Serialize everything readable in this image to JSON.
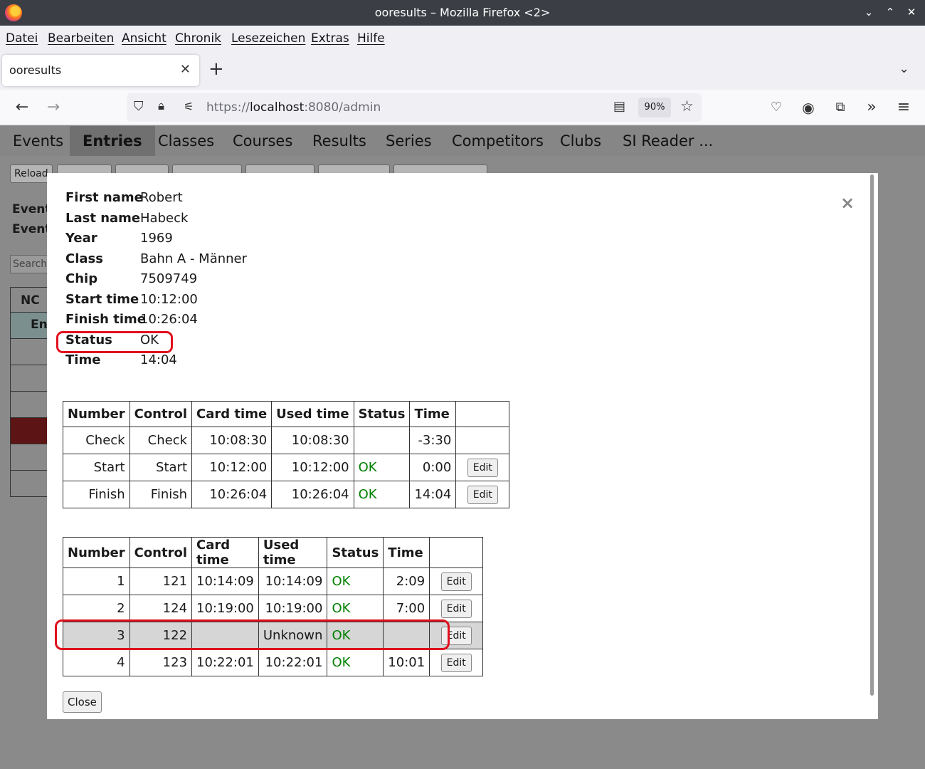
{
  "window": {
    "title": "ooresults – Mozilla Firefox <2>"
  },
  "menu": [
    "Datei",
    "Bearbeiten",
    "Ansicht",
    "Chronik",
    "Lesezeichen",
    "Extras",
    "Hilfe"
  ],
  "tab": {
    "title": "ooresults"
  },
  "url": {
    "scheme": "https://",
    "host": "localhost",
    "rest": ":8080/admin",
    "zoom": "90%"
  },
  "topnav": [
    "Events",
    "Entries",
    "Classes",
    "Courses",
    "Results",
    "Series",
    "Competitors",
    "Clubs",
    "SI Reader ..."
  ],
  "background": {
    "reload_label": "Reload",
    "event_label_1": "Event",
    "event_label_2": "Event",
    "search_placeholder": "Search",
    "table_head": "NC",
    "table_sub": "Ent"
  },
  "details": [
    {
      "label": "First name",
      "value": "Robert"
    },
    {
      "label": "Last name",
      "value": "Habeck"
    },
    {
      "label": "Year",
      "value": "1969"
    },
    {
      "label": "Class",
      "value": "Bahn A - Männer"
    },
    {
      "label": "Chip",
      "value": "7509749"
    },
    {
      "label": "Start time",
      "value": "10:12:00"
    },
    {
      "label": "Finish time",
      "value": "10:26:04"
    },
    {
      "label": "Status",
      "value": "OK"
    },
    {
      "label": "Time",
      "value": "14:04"
    }
  ],
  "columns": [
    "Number",
    "Control",
    "Card time",
    "Used time",
    "Status",
    "Time",
    ""
  ],
  "edit_label": "Edit",
  "table1": [
    {
      "number": "Check",
      "control": "Check",
      "card_time": "10:08:30",
      "used_time": "10:08:30",
      "status": "",
      "time": "-3:30",
      "edit": false
    },
    {
      "number": "Start",
      "control": "Start",
      "card_time": "10:12:00",
      "used_time": "10:12:00",
      "status": "OK",
      "time": "0:00",
      "edit": true
    },
    {
      "number": "Finish",
      "control": "Finish",
      "card_time": "10:26:04",
      "used_time": "10:26:04",
      "status": "OK",
      "time": "14:04",
      "edit": true
    }
  ],
  "table2": [
    {
      "number": "1",
      "control": "121",
      "card_time": "10:14:09",
      "used_time": "10:14:09",
      "status": "OK",
      "time": "2:09",
      "edit": true
    },
    {
      "number": "2",
      "control": "124",
      "card_time": "10:19:00",
      "used_time": "10:19:00",
      "status": "OK",
      "time": "7:00",
      "edit": true
    },
    {
      "number": "3",
      "control": "122",
      "card_time": "",
      "used_time": "Unknown",
      "status": "OK",
      "time": "",
      "edit": true,
      "selected": true
    },
    {
      "number": "4",
      "control": "123",
      "card_time": "10:22:01",
      "used_time": "10:22:01",
      "status": "OK",
      "time": "10:01",
      "edit": true
    }
  ],
  "close_label": "Close",
  "close_x": "×",
  "colors": {
    "ok": "#008000",
    "highlight": "#e0101e",
    "selected_row": "#d6d6d6"
  }
}
